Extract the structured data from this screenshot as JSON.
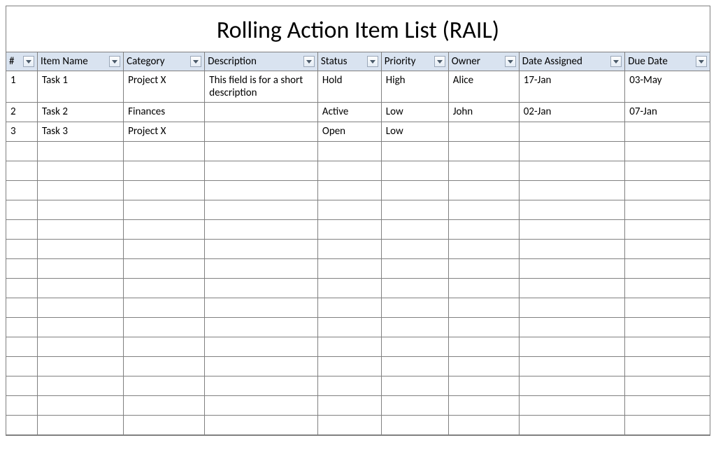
{
  "title": "Rolling Action Item List (RAIL)",
  "columns": [
    {
      "key": "num",
      "label": "#"
    },
    {
      "key": "item_name",
      "label": "Item Name"
    },
    {
      "key": "category",
      "label": "Category"
    },
    {
      "key": "description",
      "label": "Description"
    },
    {
      "key": "status",
      "label": "Status"
    },
    {
      "key": "priority",
      "label": "Priority"
    },
    {
      "key": "owner",
      "label": "Owner"
    },
    {
      "key": "date_assigned",
      "label": "Date Assigned"
    },
    {
      "key": "due_date",
      "label": "Due Date"
    }
  ],
  "rows": [
    {
      "num": "1",
      "item_name": "Task 1",
      "category": "Project X",
      "description": "This field is for a short description",
      "status": "Hold",
      "priority": "High",
      "owner": "Alice",
      "date_assigned": "17-Jan",
      "due_date": "03-May"
    },
    {
      "num": "2",
      "item_name": "Task 2",
      "category": "Finances",
      "description": "",
      "status": "Active",
      "priority": "Low",
      "owner": "John",
      "date_assigned": "02-Jan",
      "due_date": "07-Jan"
    },
    {
      "num": "3",
      "item_name": "Task 3",
      "category": "Project X",
      "description": "",
      "status": "Open",
      "priority": "Low",
      "owner": "",
      "date_assigned": "",
      "due_date": ""
    }
  ],
  "empty_row_count": 15,
  "colors": {
    "header_bg": "#d9e3f0",
    "border": "#808080"
  }
}
